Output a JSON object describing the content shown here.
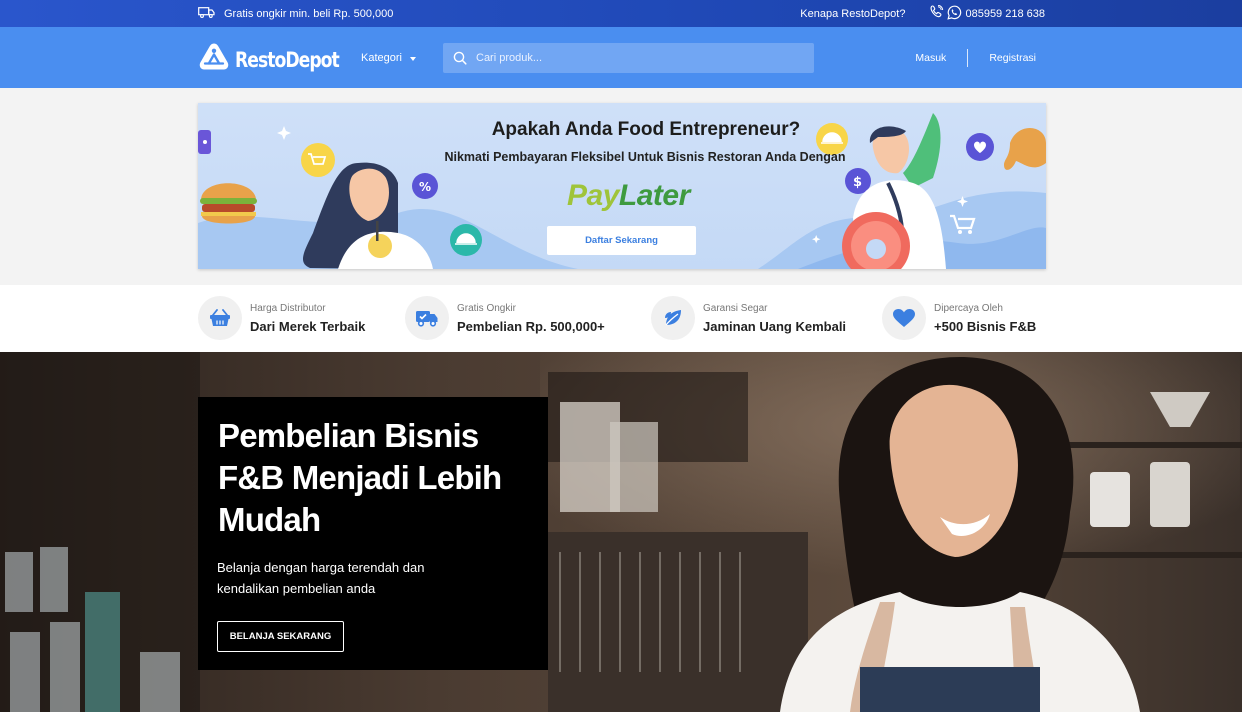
{
  "topbar": {
    "shipping_text": "Gratis ongkir min. beli Rp. 500,000",
    "why_link": "Kenapa RestoDepot?",
    "phone": "085959 218 638"
  },
  "header": {
    "logo_text": "RestoDepot",
    "kategori_label": "Kategori",
    "search_placeholder": "Cari produk...",
    "login_label": "Masuk",
    "register_label": "Registrasi"
  },
  "banner": {
    "title": "Apakah Anda Food Entrepreneur?",
    "subtitle": "Nikmati Pembayaran Fleksibel Untuk Bisnis Restoran Anda Dengan",
    "paylater_pay": "Pay",
    "paylater_later": "Later",
    "cta_label": "Daftar Sekarang"
  },
  "features": [
    {
      "small": "Harga Distributor",
      "big": "Dari Merek Terbaik",
      "icon": "basket-icon"
    },
    {
      "small": "Gratis Ongkir",
      "big": "Pembelian Rp. 500,000+",
      "icon": "truck-icon"
    },
    {
      "small": "Garansi Segar",
      "big": "Jaminan Uang Kembali",
      "icon": "leaf-icon"
    },
    {
      "small": "Dipercaya Oleh",
      "big": "+500 Bisnis F&B",
      "icon": "heart-icon"
    }
  ],
  "hero": {
    "title": "Pembelian Bisnis F&B Menjadi Lebih Mudah",
    "description": "Belanja dengan harga terendah dan kendalikan pembelian anda",
    "cta_label": "BELANJA SEKARANG"
  },
  "colors": {
    "topbar": "#1f48b5",
    "header": "#4a8ef0",
    "accent_blue": "#3b7fe0",
    "paylater_light": "#9fc43a",
    "paylater_dark": "#3e9a3f"
  }
}
